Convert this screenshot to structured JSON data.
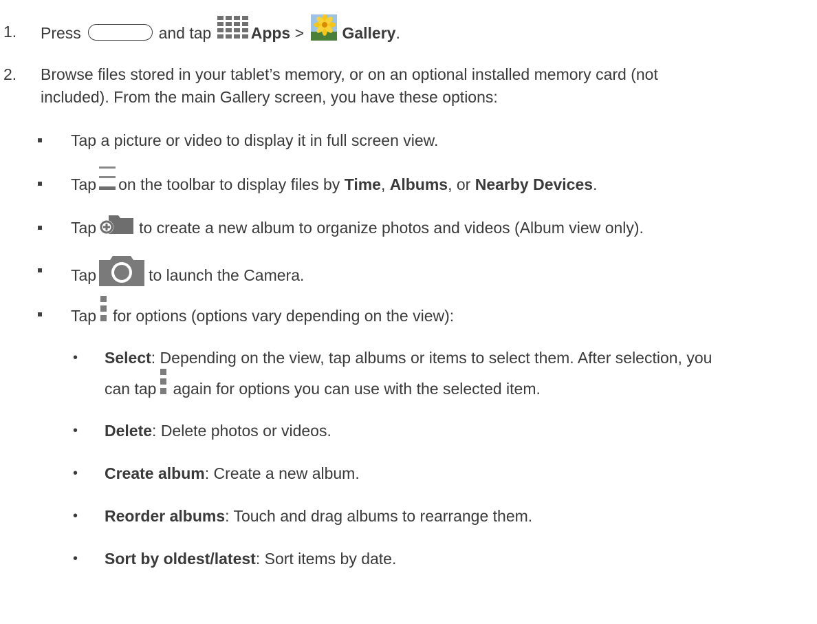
{
  "step1": {
    "num": "1.",
    "press": "Press",
    "and_tap": "and tap",
    "apps": "Apps",
    "gt": ">",
    "gallery": "Gallery",
    "period": "."
  },
  "step2": {
    "num": "2.",
    "line1": "Browse files stored in your tablet’s memory, or on an optional installed memory card (not",
    "line2": "included). From the main Gallery screen, you have these options:"
  },
  "bullets": {
    "b1": "Tap a picture or video to display it in full screen view.",
    "b2": {
      "tap": "Tap",
      "mid": "on the toolbar to display files by",
      "time": "Time",
      "comma1": ",",
      "albums": "Albums",
      "or": ", or",
      "nearby": "Nearby Devices",
      "end": "."
    },
    "b3": {
      "tap": "Tap",
      "rest": "to create a new album to organize photos and videos (Album view only)."
    },
    "b4": {
      "tap": "Tap",
      "rest": "to launch the Camera."
    },
    "b5": {
      "tap": "Tap",
      "rest": "for options (options vary depending on the view):"
    }
  },
  "subbullets": {
    "bullet_char": "•",
    "select": {
      "term": "Select",
      "line1": ": Depending on the view, tap albums or items to select them. After selection, you",
      "line2a": "can tap",
      "line2b": "again for options you can use with the selected item."
    },
    "delete": {
      "term": "Delete",
      "rest": ": Delete photos or videos."
    },
    "create": {
      "term": "Create album",
      "rest": ": Create a new album."
    },
    "reorder": {
      "term": "Reorder albums",
      "rest": ": Touch and drag albums to rearrange them."
    },
    "sort": {
      "term": "Sort by oldest/latest",
      "rest": ": Sort items by date."
    }
  },
  "icons": {
    "home": "home-button-icon",
    "apps": "apps-grid-icon",
    "gallery": "gallery-icon",
    "menu": "hamburger-menu-icon",
    "new_album": "new-album-icon",
    "camera": "camera-icon",
    "overflow": "overflow-menu-icon"
  },
  "colors": {
    "text": "#3a3a3a",
    "icon_gray": "#8a8a8a",
    "camera_gray": "#7a7a7a",
    "gallery_bg": "#8fb7dd",
    "gallery_flower": "#f5c518"
  }
}
